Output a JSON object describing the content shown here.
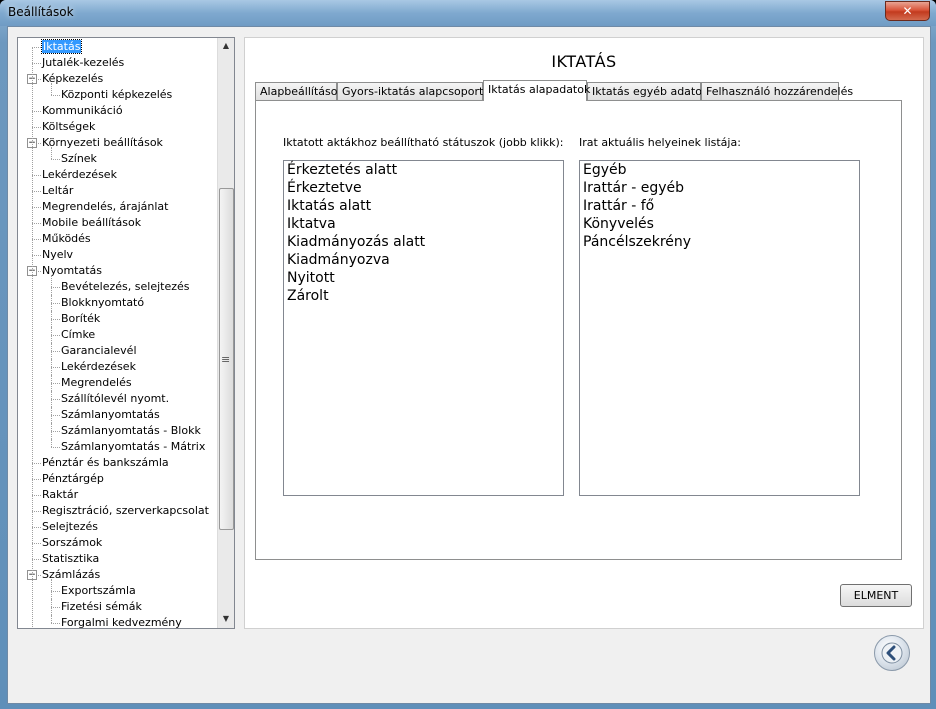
{
  "window": {
    "title": "Beállítások",
    "close_glyph": "✕"
  },
  "tree": {
    "items": [
      {
        "label": "Iktatás",
        "level": 0,
        "expander": "",
        "selected": true
      },
      {
        "label": "Jutalék-kezelés",
        "level": 0,
        "expander": ""
      },
      {
        "label": "Képkezelés",
        "level": 0,
        "expander": "−"
      },
      {
        "label": "Központi képkezelés",
        "level": 1,
        "expander": ""
      },
      {
        "label": "Kommunikáció",
        "level": 0,
        "expander": ""
      },
      {
        "label": "Költségek",
        "level": 0,
        "expander": ""
      },
      {
        "label": "Környezeti beállítások",
        "level": 0,
        "expander": "−"
      },
      {
        "label": "Színek",
        "level": 1,
        "expander": ""
      },
      {
        "label": "Lekérdezések",
        "level": 0,
        "expander": ""
      },
      {
        "label": "Leltár",
        "level": 0,
        "expander": ""
      },
      {
        "label": "Megrendelés, árajánlat",
        "level": 0,
        "expander": ""
      },
      {
        "label": "Mobile beállítások",
        "level": 0,
        "expander": ""
      },
      {
        "label": "Működés",
        "level": 0,
        "expander": ""
      },
      {
        "label": "Nyelv",
        "level": 0,
        "expander": ""
      },
      {
        "label": "Nyomtatás",
        "level": 0,
        "expander": "−"
      },
      {
        "label": "Bevételezés, selejtezés",
        "level": 1,
        "expander": ""
      },
      {
        "label": "Blokknyomtató",
        "level": 1,
        "expander": ""
      },
      {
        "label": "Boríték",
        "level": 1,
        "expander": ""
      },
      {
        "label": "Címke",
        "level": 1,
        "expander": ""
      },
      {
        "label": "Garancialevél",
        "level": 1,
        "expander": ""
      },
      {
        "label": "Lekérdezések",
        "level": 1,
        "expander": ""
      },
      {
        "label": "Megrendelés",
        "level": 1,
        "expander": ""
      },
      {
        "label": "Szállítólevél nyomt.",
        "level": 1,
        "expander": ""
      },
      {
        "label": "Számlanyomtatás",
        "level": 1,
        "expander": ""
      },
      {
        "label": "Számlanyomtatás - Blokk",
        "level": 1,
        "expander": ""
      },
      {
        "label": "Számlanyomtatás - Mátrix",
        "level": 1,
        "expander": ""
      },
      {
        "label": "Pénztár és bankszámla",
        "level": 0,
        "expander": ""
      },
      {
        "label": "Pénztárgép",
        "level": 0,
        "expander": ""
      },
      {
        "label": "Raktár",
        "level": 0,
        "expander": ""
      },
      {
        "label": "Regisztráció, szerverkapcsolat",
        "level": 0,
        "expander": ""
      },
      {
        "label": "Selejtezés",
        "level": 0,
        "expander": ""
      },
      {
        "label": "Sorszámok",
        "level": 0,
        "expander": ""
      },
      {
        "label": "Statisztika",
        "level": 0,
        "expander": ""
      },
      {
        "label": "Számlázás",
        "level": 0,
        "expander": "−"
      },
      {
        "label": "Exportszámla",
        "level": 1,
        "expander": ""
      },
      {
        "label": "Fizetési sémák",
        "level": 1,
        "expander": ""
      },
      {
        "label": "Forgalmi kedvezmény",
        "level": 1,
        "expander": ""
      }
    ],
    "scroll_up": "▲",
    "scroll_down": "▼",
    "grip": "≡"
  },
  "panel": {
    "title": "IKTATÁS",
    "tabs": [
      {
        "label": "Alapbeállítások",
        "active": false
      },
      {
        "label": "Gyors-iktatás alapcsoportjai",
        "active": false
      },
      {
        "label": "Iktatás alapadatok",
        "active": true
      },
      {
        "label": "Iktatás egyéb adatok",
        "active": false
      },
      {
        "label": "Felhasználó hozzárendelés",
        "active": false
      }
    ],
    "left_caption": "Iktatott aktákhoz beállítható státuszok (jobb klikk):",
    "right_caption": "Irat aktuális helyeinek listája:",
    "statuses": [
      "Érkeztetés alatt",
      "Érkeztetve",
      "Iktatás alatt",
      "Iktatva",
      "Kiadmányozás alatt",
      "Kiadmányozva",
      "Nyitott",
      "Zárolt"
    ],
    "locations": [
      "Egyéb",
      "Irattár - egyéb",
      "Irattár - fő",
      "Könyvelés",
      "Páncélszekrény"
    ],
    "save_button": "ELMENT"
  },
  "colors": {
    "selection": "#3399ff",
    "titlebar": "#7fa9cf",
    "close": "#c23a1e"
  },
  "icons": {
    "back": "back-arrow-icon",
    "close": "close-icon",
    "expander": "collapse-icon"
  }
}
